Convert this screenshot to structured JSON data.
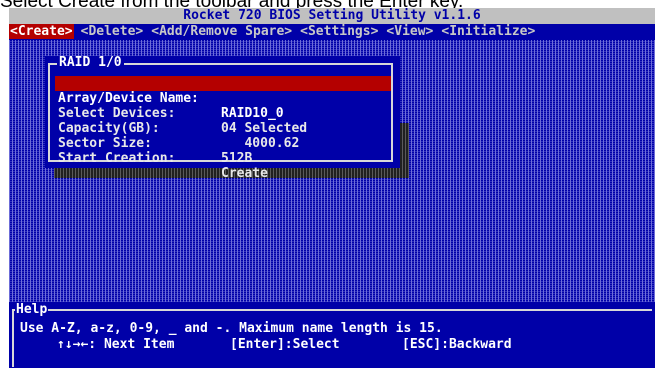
{
  "caption": "Select Create from the toolbar and press the Enter key.",
  "app": {
    "title": "Rocket 720 BIOS Setting Utility v1.1.6"
  },
  "menu": [
    {
      "label": "<Create>",
      "active": true
    },
    {
      "label": "<Delete>"
    },
    {
      "label": "<Add/Remove Spare>"
    },
    {
      "label": "<Settings>"
    },
    {
      "label": "<View>"
    },
    {
      "label": "<Initialize>"
    }
  ],
  "dialog": {
    "title": "RAID 1/0",
    "rows": [
      {
        "label": "Array/Device Name:",
        "value": "RAID10_0",
        "selected": true
      },
      {
        "label": "Select Devices:",
        "value": "04 Selected"
      },
      {
        "label": "Capacity(GB):",
        "value": "   4000.62"
      },
      {
        "label": "Sector Size:",
        "value": "512B"
      },
      {
        "label": "Start Creation:",
        "value": "Create"
      }
    ]
  },
  "help": {
    "title": "Help",
    "line1": "Use A-Z, a-z, 0-9, _ and -. Maximum name length is 15.",
    "keys": [
      {
        "text": "↑↓→←: Next Item"
      },
      {
        "text": "[Enter]:Select"
      },
      {
        "text": "[ESC]:Backward"
      }
    ]
  },
  "colors": {
    "bios_blue": "#0000a8",
    "highlight_red": "#b40000",
    "title_gray": "#c0c0c0"
  }
}
